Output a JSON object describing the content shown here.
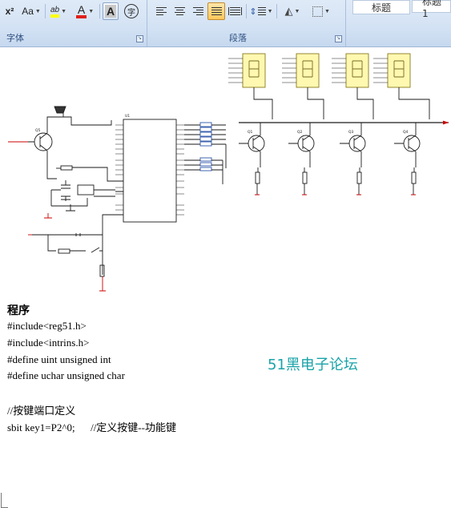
{
  "ribbon": {
    "font_group": {
      "label": "字体",
      "superscript_label": "x²",
      "change_case_label": "Aa",
      "highlight_label": "ab",
      "font_color_label": "A",
      "char_shading_label": "A",
      "enclose_char_label": "字"
    },
    "paragraph_group": {
      "label": "段落"
    },
    "styles_group": {
      "style_items": [
        "标题",
        "标题 1"
      ]
    },
    "colors": {
      "highlight": "#ffff00",
      "font_color": "#e0201b",
      "active_button": "#ffc75a"
    }
  },
  "schematic": {
    "transistor_labels": [
      "Q5",
      "Q1",
      "Q2",
      "Q3",
      "Q4"
    ],
    "chip_label": "U1",
    "resistor_labels": [
      "R2",
      "R3",
      "R4",
      "R5",
      "R6",
      "R7",
      "R8"
    ]
  },
  "document": {
    "heading": "程序",
    "code_lines": [
      "#include<reg51.h>",
      "#include<intrins.h>",
      "#define uint unsigned int",
      "#define uchar unsigned char",
      "",
      "//按键端口定义",
      "sbit key1=P2^0;      //定义按键--功能键"
    ],
    "watermark": "51黑电子论坛"
  }
}
